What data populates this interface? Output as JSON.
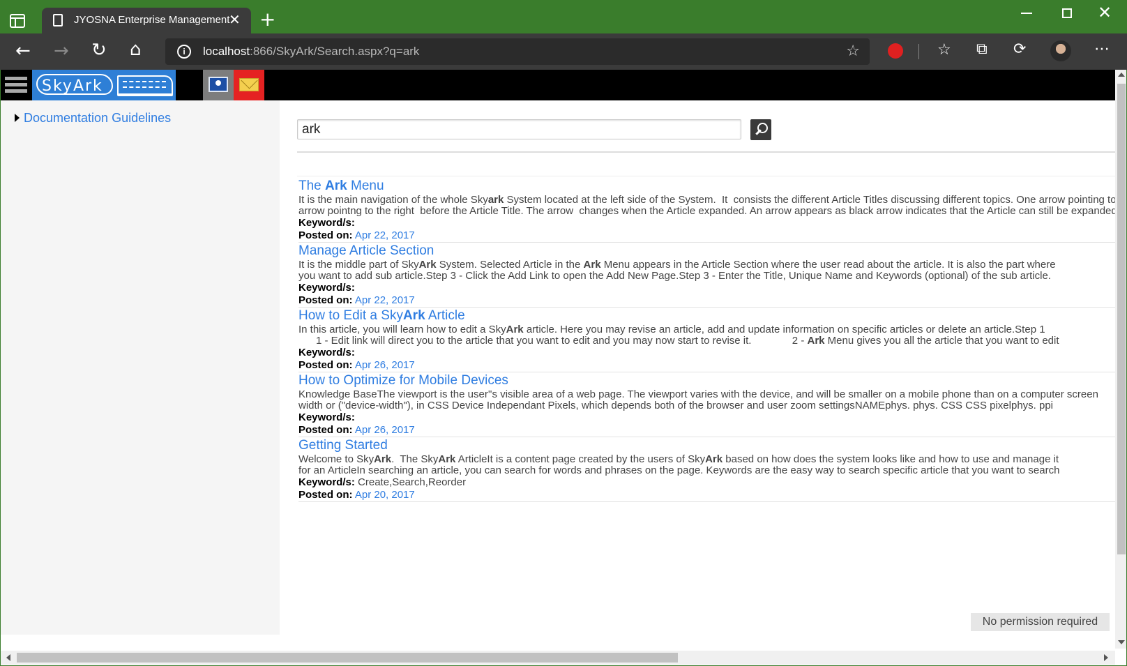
{
  "browser": {
    "tab_title": "JYOSNA Enterprise Management",
    "tab_close": "✕",
    "new_tab": "+",
    "close_window": "✕",
    "back": "←",
    "forward": "→",
    "reload": "↻",
    "home": "⌂",
    "url_host": "localhost",
    "url_rest": ":866/SkyArk/Search.aspx?q=ark",
    "fav_add": "☆",
    "favorites": "☆",
    "collections": "⧉",
    "extensions": "⟳",
    "more": "⋯"
  },
  "app": {
    "logo_text": "SkyArk"
  },
  "sidebar": {
    "items": [
      {
        "label": "Documentation Guidelines"
      }
    ]
  },
  "search": {
    "value": "ark"
  },
  "labels": {
    "keywords": "Keyword/s:",
    "posted_on": "Posted on:"
  },
  "results": [
    {
      "title_pre": "The ",
      "title_bold": "Ark",
      "title_post": " Menu",
      "line1_pre": "It is the main navigation of the whole Sky",
      "line1_bold": "ark",
      "line1_post": " System located at the left side of the System.  It  consists the different Article Titles discussing different topics. One arrow pointing to the right",
      "line2": "arrow pointng to the right  before the Article Title. The arrow  changes when the Article expanded. An arrow appears as black arrow indicates that the Article can still be expanded",
      "keywords": "",
      "date": "Apr 22, 2017"
    },
    {
      "title": "Manage Article Section",
      "line1_a": "It is the middle part of Sky",
      "line1_b": "Ark",
      "line1_c": " System. Selected Article in the ",
      "line1_d": "Ark",
      "line1_e": " Menu appears in the Article Section where the user read about the article. It is also the part where",
      "line2": "you want to add sub article.Step 3 - Click the Add Link to open the Add New Page.Step 3 - Enter the Title, Unique Name and Keywords (optional) of the sub article.",
      "keywords": "",
      "date": "Apr 22, 2017"
    },
    {
      "title_pre": "How to Edit a Sky",
      "title_bold": "Ark",
      "title_post": " Article",
      "line1_pre": "In this article, you will learn how to edit a Sky",
      "line1_bold": "Ark",
      "line1_post": " article. Here you may revise an article, add and update information on specific articles or delete an article.Step 1",
      "line2_pre": "      1 - Edit link will direct you to the article that you want to edit and you may now start to revise it.              2 - ",
      "line2_bold": "Ark",
      "line2_post": " Menu gives you all the article that you want to edit",
      "keywords": "",
      "date": "Apr 26, 2017"
    },
    {
      "title": "How to Optimize for Mobile Devices",
      "line1": "Knowledge BaseThe viewport is the user''s visible area of a web page. The viewport varies with the device, and will be smaller on a mobile phone than on a computer screen",
      "line2": "width or (\"device-width\"), in CSS Device Independant Pixels, which depends both of the browser and user zoom settingsNAMEphys. phys. CSS CSS pixelphys. ppi",
      "keywords": "",
      "date": "Apr 26, 2017"
    },
    {
      "title": "Getting Started",
      "line1_a": "Welcome to Sky",
      "line1_b": "Ark",
      "line1_c": ".  The Sky",
      "line1_d": "Ark",
      "line1_e": " ArticleIt is a content page created by the users of Sky",
      "line1_f": "Ark",
      "line1_g": " based on how does the system looks like and how to use and manage it",
      "line2": "for an ArticleIn searching an article, you can search for words and phrases on the page. Keywords are the easy way to search specific article that you want to search",
      "keywords": "Create,Search,Reorder",
      "date": "Apr 20, 2017"
    }
  ],
  "footer": {
    "status": "No permission required"
  },
  "colors": {
    "accent": "#2f7de1",
    "titlebar": "#3a7d2c",
    "logo_bg": "#2e7fd6"
  },
  "icons": [
    "tab-actions-icon",
    "document-icon",
    "info-icon",
    "star-add-icon",
    "adblock-icon",
    "favorites-icon",
    "collections-icon",
    "extensions-icon",
    "profile-avatar",
    "menu-icon",
    "profile-card-icon",
    "mail-icon",
    "search-icon"
  ]
}
